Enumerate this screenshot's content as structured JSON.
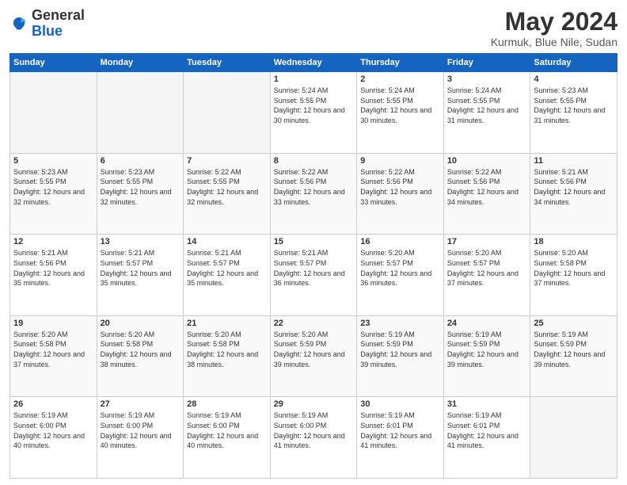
{
  "header": {
    "logo": {
      "general": "General",
      "blue": "Blue"
    },
    "title": "May 2024",
    "location": "Kurmuk, Blue Nile, Sudan"
  },
  "weekdays": [
    "Sunday",
    "Monday",
    "Tuesday",
    "Wednesday",
    "Thursday",
    "Friday",
    "Saturday"
  ],
  "weeks": [
    [
      {
        "day": "",
        "sunrise": "",
        "sunset": "",
        "daylight": "",
        "empty": true
      },
      {
        "day": "",
        "sunrise": "",
        "sunset": "",
        "daylight": "",
        "empty": true
      },
      {
        "day": "",
        "sunrise": "",
        "sunset": "",
        "daylight": "",
        "empty": true
      },
      {
        "day": "1",
        "sunrise": "Sunrise: 5:24 AM",
        "sunset": "Sunset: 5:55 PM",
        "daylight": "Daylight: 12 hours and 30 minutes.",
        "empty": false
      },
      {
        "day": "2",
        "sunrise": "Sunrise: 5:24 AM",
        "sunset": "Sunset: 5:55 PM",
        "daylight": "Daylight: 12 hours and 30 minutes.",
        "empty": false
      },
      {
        "day": "3",
        "sunrise": "Sunrise: 5:24 AM",
        "sunset": "Sunset: 5:55 PM",
        "daylight": "Daylight: 12 hours and 31 minutes.",
        "empty": false
      },
      {
        "day": "4",
        "sunrise": "Sunrise: 5:23 AM",
        "sunset": "Sunset: 5:55 PM",
        "daylight": "Daylight: 12 hours and 31 minutes.",
        "empty": false
      }
    ],
    [
      {
        "day": "5",
        "sunrise": "Sunrise: 5:23 AM",
        "sunset": "Sunset: 5:55 PM",
        "daylight": "Daylight: 12 hours and 32 minutes.",
        "empty": false
      },
      {
        "day": "6",
        "sunrise": "Sunrise: 5:23 AM",
        "sunset": "Sunset: 5:55 PM",
        "daylight": "Daylight: 12 hours and 32 minutes.",
        "empty": false
      },
      {
        "day": "7",
        "sunrise": "Sunrise: 5:22 AM",
        "sunset": "Sunset: 5:55 PM",
        "daylight": "Daylight: 12 hours and 32 minutes.",
        "empty": false
      },
      {
        "day": "8",
        "sunrise": "Sunrise: 5:22 AM",
        "sunset": "Sunset: 5:56 PM",
        "daylight": "Daylight: 12 hours and 33 minutes.",
        "empty": false
      },
      {
        "day": "9",
        "sunrise": "Sunrise: 5:22 AM",
        "sunset": "Sunset: 5:56 PM",
        "daylight": "Daylight: 12 hours and 33 minutes.",
        "empty": false
      },
      {
        "day": "10",
        "sunrise": "Sunrise: 5:22 AM",
        "sunset": "Sunset: 5:56 PM",
        "daylight": "Daylight: 12 hours and 34 minutes.",
        "empty": false
      },
      {
        "day": "11",
        "sunrise": "Sunrise: 5:21 AM",
        "sunset": "Sunset: 5:56 PM",
        "daylight": "Daylight: 12 hours and 34 minutes.",
        "empty": false
      }
    ],
    [
      {
        "day": "12",
        "sunrise": "Sunrise: 5:21 AM",
        "sunset": "Sunset: 5:56 PM",
        "daylight": "Daylight: 12 hours and 35 minutes.",
        "empty": false
      },
      {
        "day": "13",
        "sunrise": "Sunrise: 5:21 AM",
        "sunset": "Sunset: 5:57 PM",
        "daylight": "Daylight: 12 hours and 35 minutes.",
        "empty": false
      },
      {
        "day": "14",
        "sunrise": "Sunrise: 5:21 AM",
        "sunset": "Sunset: 5:57 PM",
        "daylight": "Daylight: 12 hours and 35 minutes.",
        "empty": false
      },
      {
        "day": "15",
        "sunrise": "Sunrise: 5:21 AM",
        "sunset": "Sunset: 5:57 PM",
        "daylight": "Daylight: 12 hours and 36 minutes.",
        "empty": false
      },
      {
        "day": "16",
        "sunrise": "Sunrise: 5:20 AM",
        "sunset": "Sunset: 5:57 PM",
        "daylight": "Daylight: 12 hours and 36 minutes.",
        "empty": false
      },
      {
        "day": "17",
        "sunrise": "Sunrise: 5:20 AM",
        "sunset": "Sunset: 5:57 PM",
        "daylight": "Daylight: 12 hours and 37 minutes.",
        "empty": false
      },
      {
        "day": "18",
        "sunrise": "Sunrise: 5:20 AM",
        "sunset": "Sunset: 5:58 PM",
        "daylight": "Daylight: 12 hours and 37 minutes.",
        "empty": false
      }
    ],
    [
      {
        "day": "19",
        "sunrise": "Sunrise: 5:20 AM",
        "sunset": "Sunset: 5:58 PM",
        "daylight": "Daylight: 12 hours and 37 minutes.",
        "empty": false
      },
      {
        "day": "20",
        "sunrise": "Sunrise: 5:20 AM",
        "sunset": "Sunset: 5:58 PM",
        "daylight": "Daylight: 12 hours and 38 minutes.",
        "empty": false
      },
      {
        "day": "21",
        "sunrise": "Sunrise: 5:20 AM",
        "sunset": "Sunset: 5:58 PM",
        "daylight": "Daylight: 12 hours and 38 minutes.",
        "empty": false
      },
      {
        "day": "22",
        "sunrise": "Sunrise: 5:20 AM",
        "sunset": "Sunset: 5:59 PM",
        "daylight": "Daylight: 12 hours and 39 minutes.",
        "empty": false
      },
      {
        "day": "23",
        "sunrise": "Sunrise: 5:19 AM",
        "sunset": "Sunset: 5:59 PM",
        "daylight": "Daylight: 12 hours and 39 minutes.",
        "empty": false
      },
      {
        "day": "24",
        "sunrise": "Sunrise: 5:19 AM",
        "sunset": "Sunset: 5:59 PM",
        "daylight": "Daylight: 12 hours and 39 minutes.",
        "empty": false
      },
      {
        "day": "25",
        "sunrise": "Sunrise: 5:19 AM",
        "sunset": "Sunset: 5:59 PM",
        "daylight": "Daylight: 12 hours and 39 minutes.",
        "empty": false
      }
    ],
    [
      {
        "day": "26",
        "sunrise": "Sunrise: 5:19 AM",
        "sunset": "Sunset: 6:00 PM",
        "daylight": "Daylight: 12 hours and 40 minutes.",
        "empty": false
      },
      {
        "day": "27",
        "sunrise": "Sunrise: 5:19 AM",
        "sunset": "Sunset: 6:00 PM",
        "daylight": "Daylight: 12 hours and 40 minutes.",
        "empty": false
      },
      {
        "day": "28",
        "sunrise": "Sunrise: 5:19 AM",
        "sunset": "Sunset: 6:00 PM",
        "daylight": "Daylight: 12 hours and 40 minutes.",
        "empty": false
      },
      {
        "day": "29",
        "sunrise": "Sunrise: 5:19 AM",
        "sunset": "Sunset: 6:00 PM",
        "daylight": "Daylight: 12 hours and 41 minutes.",
        "empty": false
      },
      {
        "day": "30",
        "sunrise": "Sunrise: 5:19 AM",
        "sunset": "Sunset: 6:01 PM",
        "daylight": "Daylight: 12 hours and 41 minutes.",
        "empty": false
      },
      {
        "day": "31",
        "sunrise": "Sunrise: 5:19 AM",
        "sunset": "Sunset: 6:01 PM",
        "daylight": "Daylight: 12 hours and 41 minutes.",
        "empty": false
      },
      {
        "day": "",
        "sunrise": "",
        "sunset": "",
        "daylight": "",
        "empty": true
      }
    ]
  ]
}
